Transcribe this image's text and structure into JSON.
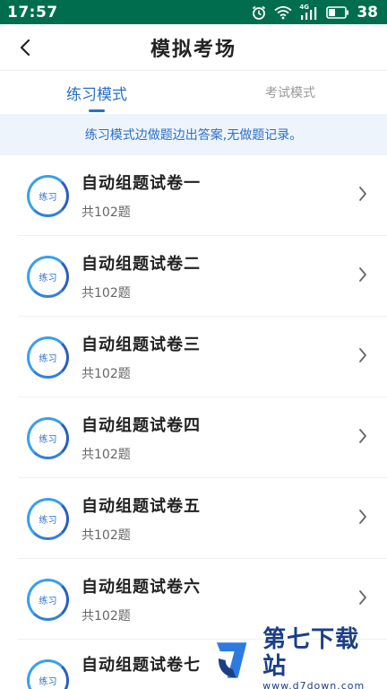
{
  "status_bar": {
    "time": "17:57",
    "network": "4G",
    "battery": "38"
  },
  "nav": {
    "title": "模拟考场"
  },
  "tabs": [
    {
      "label": "练习模式",
      "active": true
    },
    {
      "label": "考试模式",
      "active": false
    }
  ],
  "notice": "练习模式边做题边出答案,无做题记录。",
  "papers": [
    {
      "badge": "练习",
      "title": "自动组题试卷一",
      "count": "共102题"
    },
    {
      "badge": "练习",
      "title": "自动组题试卷二",
      "count": "共102题"
    },
    {
      "badge": "练习",
      "title": "自动组题试卷三",
      "count": "共102题"
    },
    {
      "badge": "练习",
      "title": "自动组题试卷四",
      "count": "共102题"
    },
    {
      "badge": "练习",
      "title": "自动组题试卷五",
      "count": "共102题"
    },
    {
      "badge": "练习",
      "title": "自动组题试卷六",
      "count": "共102题"
    },
    {
      "badge": "练习",
      "title": "自动组题试卷七",
      "count": ""
    }
  ],
  "watermark": {
    "title": "第七下载站",
    "url": "www.d7down.com"
  },
  "colors": {
    "status_bar": "#006e4e",
    "accent": "#2a6fc9",
    "notice_bg": "#eef4fb"
  }
}
